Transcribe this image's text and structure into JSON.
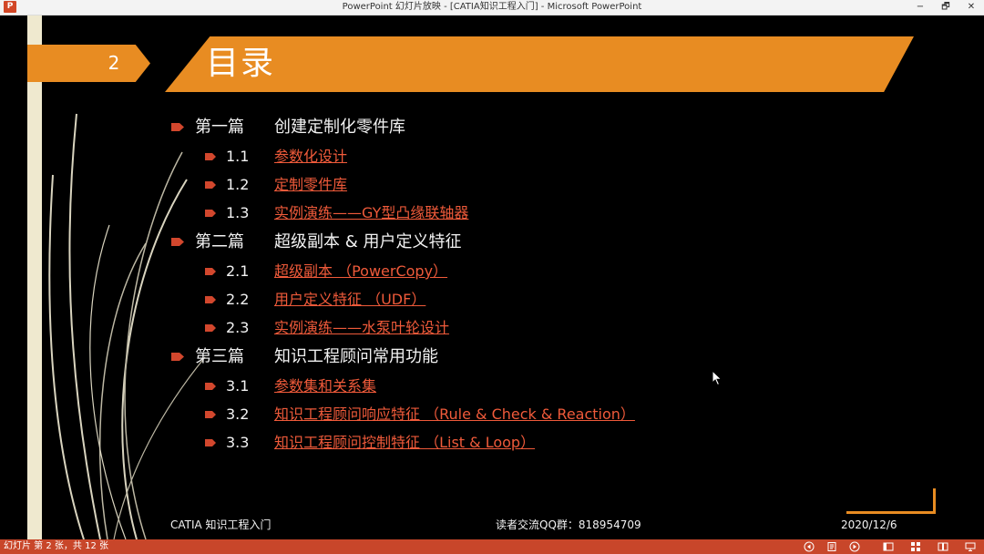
{
  "window": {
    "app_icon_letter": "P",
    "title": "PowerPoint 幻灯片放映 - [CATIA知识工程入门] - Microsoft PowerPoint",
    "buttons": {
      "minimize": "−",
      "restore": "🗗",
      "close": "✕"
    }
  },
  "slide": {
    "page_number": "2",
    "title": "目录",
    "sections": [
      {
        "num": "第一篇",
        "title": "创建定制化零件库",
        "items": [
          {
            "num": "1.1",
            "label": "参数化设计"
          },
          {
            "num": "1.2",
            "label": "定制零件库"
          },
          {
            "num": "1.3",
            "label": "实例演练——GY型凸缘联轴器"
          }
        ]
      },
      {
        "num": "第二篇",
        "title": "超级副本 & 用户定义特征",
        "items": [
          {
            "num": "2.1",
            "label": "超级副本 （PowerCopy）"
          },
          {
            "num": "2.2",
            "label": "用户定义特征 （UDF）"
          },
          {
            "num": "2.3",
            "label": "实例演练——水泵叶轮设计"
          }
        ]
      },
      {
        "num": "第三篇",
        "title": "知识工程顾问常用功能",
        "items": [
          {
            "num": "3.1",
            "label": "参数集和关系集"
          },
          {
            "num": "3.2",
            "label": "知识工程顾问响应特征 （Rule & Check & Reaction）"
          },
          {
            "num": "3.3",
            "label": "知识工程顾问控制特征 （List & Loop）"
          }
        ]
      }
    ],
    "footer": {
      "left": "CATIA 知识工程入门",
      "center": "读者交流QQ群：818954709",
      "date": "2020/12/6"
    }
  },
  "statusbar": {
    "slide_counter": "幻灯片 第 2 张，共 12 张",
    "icons": [
      "previous-icon",
      "notes-icon",
      "next-icon",
      "normal-view-icon",
      "slide-sorter-icon",
      "reading-view-icon",
      "slideshow-icon"
    ]
  },
  "colors": {
    "accent_orange": "#e88c22",
    "link_red": "#ef5a3a",
    "background": "#000000",
    "stripe": "#efe9cf",
    "statusbar": "#c8462a"
  }
}
